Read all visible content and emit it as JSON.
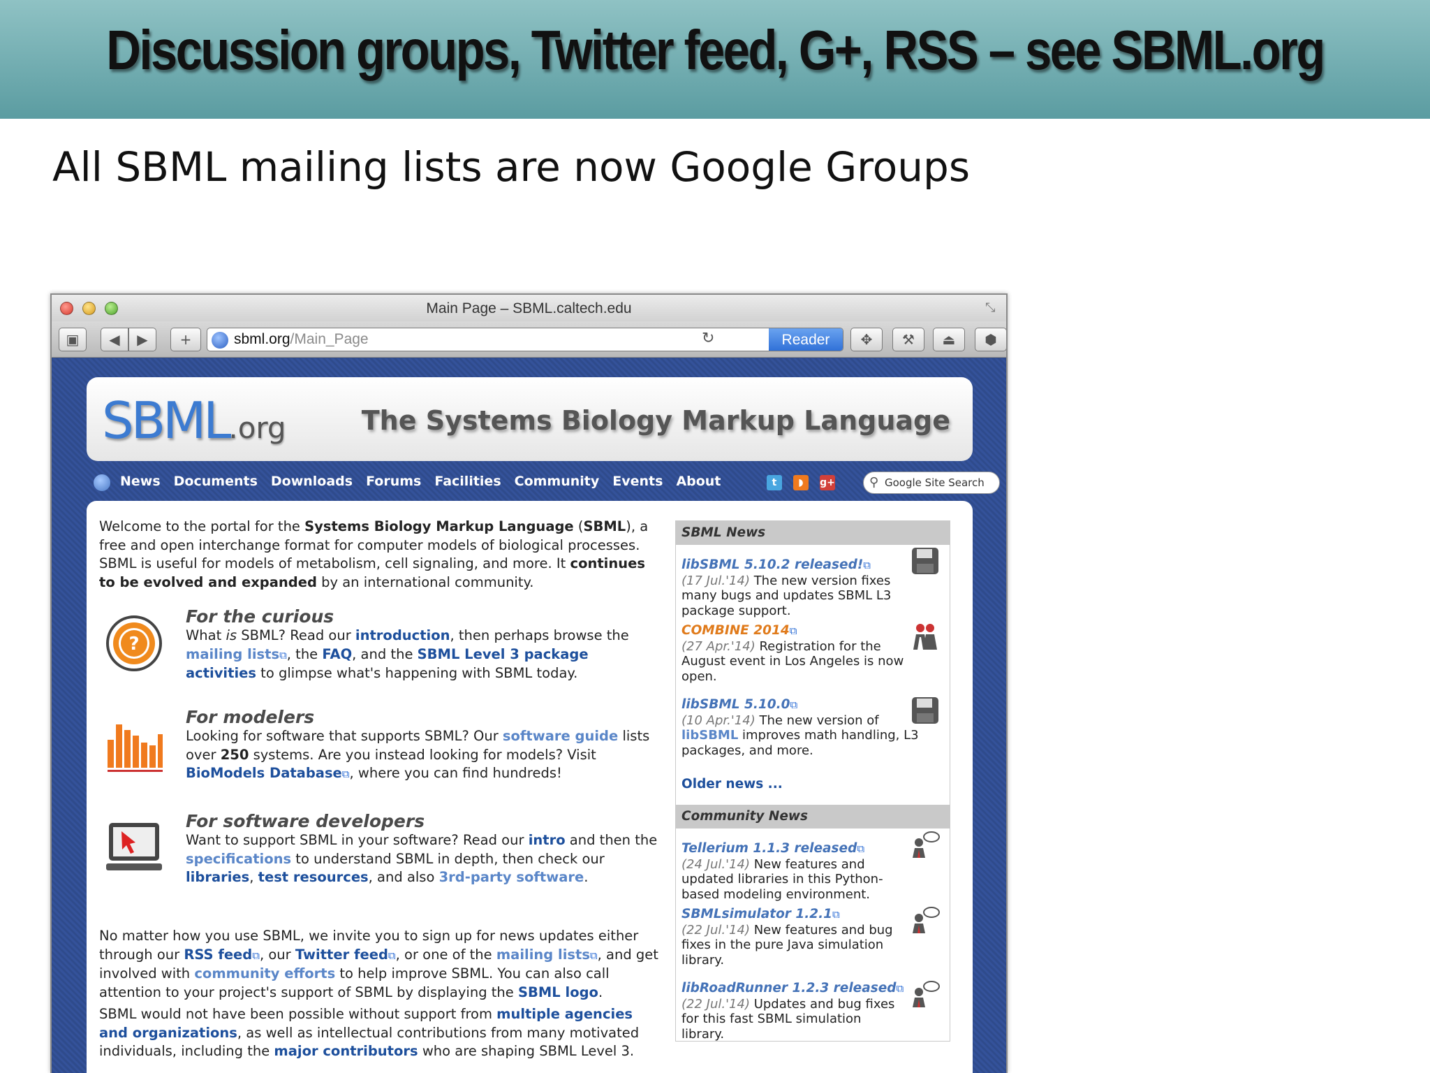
{
  "slide": {
    "title": "Discussion groups, Twitter feed, G+, RSS – see SBML.org",
    "subtitle": "All SBML mailing lists are now Google Groups"
  },
  "browser": {
    "window_title": "Main Page – SBML.caltech.edu",
    "address_host": "sbml.org",
    "address_path": "/Main_Page",
    "reader_label": "Reader",
    "toolbar_icons": [
      "sidebar-toggle-icon",
      "back-icon",
      "forward-icon",
      "add-bookmark-icon",
      "reload-icon",
      "extension-icon",
      "hammer-icon",
      "clean-icon",
      "shield-icon",
      "f-question-icon"
    ]
  },
  "site": {
    "logo_main": "SBML",
    "logo_suffix": ".org",
    "banner_title": "The Systems Biology Markup Language",
    "nav": [
      "News",
      "Documents",
      "Downloads",
      "Forums",
      "Facilities",
      "Community",
      "Events",
      "About"
    ],
    "search_placeholder": "Google Site Search",
    "intro": {
      "p1": "Welcome to the portal for the ",
      "p2": "Systems Biology Markup Language",
      "p3": " (",
      "p4": "SBML",
      "p5": "), a free and open interchange format for computer models of biological processes. SBML is useful for models of metabolism, cell signaling, and more. It ",
      "p6": "continues to be evolved and expanded",
      "p7": " by an international community."
    },
    "curious": {
      "title": "For the curious",
      "t1": "What ",
      "t2": "is",
      "t3": " SBML? Read our ",
      "t4": "introduction",
      "t5": ", then perhaps browse the ",
      "t6": "mailing lists",
      "t7": ", the ",
      "t8": "FAQ",
      "t9": ", and the ",
      "t10": "SBML Level 3 package activities",
      "t11": " to glimpse what's happening with SBML today."
    },
    "modelers": {
      "title": "For modelers",
      "t1": "Looking for software that supports SBML? Our ",
      "t2": "software guide",
      "t3": " lists over ",
      "t4": "250",
      "t5": " systems. Are you instead looking for models? Visit ",
      "t6": "BioModels Database",
      "t7": ", where you can find hundreds!"
    },
    "developers": {
      "title": "For software developers",
      "t1": "Want to support SBML in your software? Read our ",
      "t2": "intro",
      "t3": " and then the ",
      "t4": "specifications",
      "t5": " to understand SBML in depth, then check our ",
      "t6": "libraries",
      "t7": ", ",
      "t8": "test resources",
      "t9": ", and also ",
      "t10": "3rd-party software",
      "t11": "."
    },
    "signup": {
      "t1": "No matter how you use SBML, we invite you to sign up for news updates either through our ",
      "t2": "RSS feed",
      "t3": ", our ",
      "t4": "Twitter feed",
      "t5": ", or one of the ",
      "t6": "mailing lists",
      "t7": ", and get involved with ",
      "t8": "community efforts",
      "t9": " to help improve SBML. You can also call attention to your project's support of SBML by displaying the ",
      "t10": "SBML logo",
      "t11": "."
    },
    "support": {
      "t1": "SBML would not have been possible without support from ",
      "t2": "multiple agencies and organizations",
      "t3": ", as well as intellectual contributions from many motivated individuals, including the ",
      "t4": "major contributors",
      "t5": " who are shaping SBML Level 3."
    },
    "sbml_news": {
      "heading": "SBML News",
      "items": [
        {
          "title": "libSBML 5.10.2 released!",
          "date": "(17 Jul.'14)",
          "text": " The new version fixes many bugs and updates SBML L3 package support."
        },
        {
          "title": "COMBINE 2014",
          "date": "(27 Apr.'14)",
          "text": " Registration for the August event in Los Angeles is now open."
        },
        {
          "title": "libSBML 5.10.0",
          "date": "(10 Apr.'14)",
          "text1": " The new version of ",
          "link": "libSBML",
          "text2": " improves math handling, L3 packages, and more."
        }
      ],
      "older": "Older news ..."
    },
    "community_news": {
      "heading": "Community News",
      "items": [
        {
          "title": "Tellerium 1.1.3 released",
          "date": "(24 Jul.'14)",
          "text": " New features and updated libraries in this Python-based modeling environment."
        },
        {
          "title": "SBMLsimulator 1.2.1",
          "date": "(22 Jul.'14)",
          "text": " New features and bug fixes in the pure Java simulation library."
        },
        {
          "title": "libRoadRunner 1.2.3 released",
          "date": "(22 Jul.'14)",
          "text": " Updates and bug fixes for this fast SBML simulation library."
        }
      ]
    },
    "colors": {
      "site_bg": "#2f4b8c",
      "link": "#1d4f9c",
      "light_link": "#5a86c8",
      "orange": "#e07b1c"
    }
  }
}
